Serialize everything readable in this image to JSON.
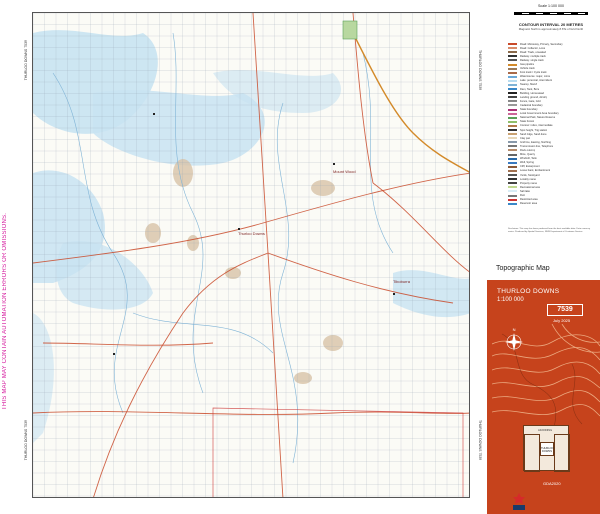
{
  "side_warning": "THIS MAP MAY CONTAIN AUTOMATION ERRORS OR OMISSIONS.",
  "adjoining": {
    "left_top": "THURLOO DOWNS 7539",
    "left_bottom": "THURLOO DOWNS 7539",
    "right_top": "THURLOO DOWNS 7539",
    "right_bottom": "THURLOO DOWNS 7539"
  },
  "legend": {
    "scale_label": "Scale 1:100 000",
    "contour_interval": "CONTOUR INTERVAL 20 METRES",
    "magnetic_note": "Magnetic North is approximately 8.6°E of Grid North",
    "items": [
      {
        "label": "Road: Motorway, Primary, Secondary",
        "color": "#c94a2a"
      },
      {
        "label": "Road: Collector, Local",
        "color": "#d98c6b"
      },
      {
        "label": "Road: Track, unsealed",
        "color": "#8a6a4a"
      },
      {
        "label": "Railway: multiple track",
        "color": "#333333"
      },
      {
        "label": "Railway: single track",
        "color": "#555555"
      },
      {
        "label": "Gas pipeline",
        "color": "#d38a2a"
      },
      {
        "label": "Vehicle track",
        "color": "#9a7a5a"
      },
      {
        "label": "Foot track / Cycle track",
        "color": "#a86a4a"
      },
      {
        "label": "Watercourse: major, minor",
        "color": "#6aa8d8"
      },
      {
        "label": "Lake: perennial, intermittent",
        "color": "#b8dcf0"
      },
      {
        "label": "Swamp, Marsh",
        "color": "#7fb3d6"
      },
      {
        "label": "Dam, Tank, Bore",
        "color": "#3a88c8"
      },
      {
        "label": "Building, Homestead",
        "color": "#222222"
      },
      {
        "label": "Landing ground, Airstrip",
        "color": "#444444"
      },
      {
        "label": "Fence, Gate, Grid",
        "color": "#888888"
      },
      {
        "label": "Cadastral boundary",
        "color": "#999999"
      },
      {
        "label": "State boundary",
        "color": "#aa3377"
      },
      {
        "label": "Local Government Area boundary",
        "color": "#cc6699"
      },
      {
        "label": "National Park, Nature Reserve",
        "color": "#5aa05a"
      },
      {
        "label": "State Forest",
        "color": "#8fbf6a"
      },
      {
        "label": "Contour: index, intermediate",
        "color": "#b07a4a"
      },
      {
        "label": "Spot height, Trig station",
        "color": "#333333"
      },
      {
        "label": "Sand ridge, Sand dune",
        "color": "#c8a070"
      },
      {
        "label": "Clay pan",
        "color": "#e6d6b8"
      },
      {
        "label": "Grid line, Easting, Northing",
        "color": "#8899aa"
      },
      {
        "label": "Transmission line, Telephone",
        "color": "#777777"
      },
      {
        "label": "Rock outcrop",
        "color": "#b48a6a"
      },
      {
        "label": "Mine, Quarry",
        "color": "#666666"
      },
      {
        "label": "Windmill, Tank",
        "color": "#2a6aa8"
      },
      {
        "label": "Well, Spring",
        "color": "#3a7ac0"
      },
      {
        "label": "Cliff, Escarpment",
        "color": "#8a5a3a"
      },
      {
        "label": "Levee bank, Embankment",
        "color": "#a07050"
      },
      {
        "label": "Yards, Stockyard",
        "color": "#555555"
      },
      {
        "label": "Locality name",
        "color": "#333333"
      },
      {
        "label": "Property name",
        "color": "#444444"
      },
      {
        "label": "Recreational area",
        "color": "#c0d890"
      },
      {
        "label": "Salt lake",
        "color": "#d8ecf5"
      },
      {
        "label": "Ruin",
        "color": "#777777"
      },
      {
        "label": "Restricted area",
        "color": "#cc3333"
      },
      {
        "label": "Reservoir area",
        "color": "#3a88c8"
      }
    ],
    "fine_print": "Disclaimer: This map has been produced from the best available data. Data currency varies. Produced by Spatial Services, NSW Department of Customer Service."
  },
  "topographic_title": "Topographic Map",
  "title_box": {
    "name": "THURLOO DOWNS",
    "scale": "1:100 000",
    "sheet_number": "7539",
    "date": "July 2025",
    "code": "GDA2020",
    "index_label": "ADJOINING",
    "index_center": "THURLOO DOWNS",
    "accent_color": "#c6431c"
  },
  "map": {
    "place_labels": [
      "Thurloo Downs",
      "Mount Wood",
      "Tiboburra"
    ],
    "lake_color": "#c8e3f2",
    "road_color": "#c94a2a",
    "grid_color": "#9aa6b6"
  }
}
